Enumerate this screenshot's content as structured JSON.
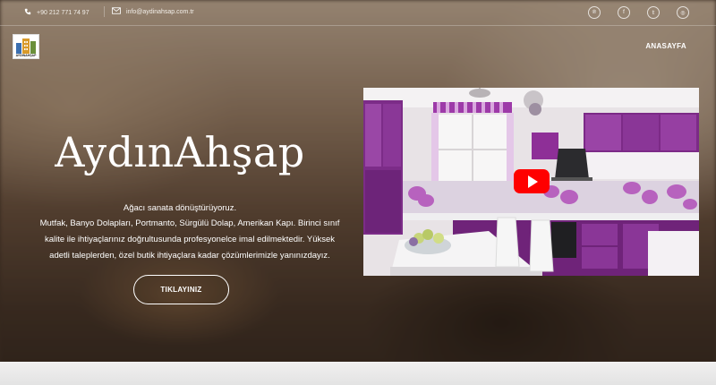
{
  "topbar": {
    "phone": "+90 212 771 74 97",
    "email": "info@aydinahsap.com.tr",
    "phone_icon": "phone-icon",
    "email_icon": "envelope-icon",
    "socials": [
      {
        "icon": "pinterest-icon",
        "glyph": "℗"
      },
      {
        "icon": "facebook-icon",
        "glyph": "f"
      },
      {
        "icon": "twitter-icon",
        "glyph": "𝕥"
      },
      {
        "icon": "instagram-icon",
        "glyph": "◎"
      }
    ]
  },
  "logo": {
    "text": "AYDINAHŞAP"
  },
  "nav": {
    "home": "ANASAYFA"
  },
  "hero": {
    "title": "AydınAhşap",
    "subtitle": "Ağacı sanata dönüştürüyoruz.",
    "description": "Mutfak, Banyo Dolapları, Portmanto, Sürgülü Dolap, Amerikan Kapı. Birinci sınıf kalite ile ihtiyaçlarınız doğrultusunda profesyonelce imal edilmektedir. Yüksek adetli taleplerden, özel butik ihtiyaçlara kadar çözümlerimizle yanınızdayız.",
    "cta": "TIKLAYINIZ"
  },
  "video": {
    "play_icon": "youtube-play-icon"
  },
  "colors": {
    "accent": "#ff0000",
    "cabinet_purple": "#7b2d86",
    "text": "#ffffff"
  }
}
